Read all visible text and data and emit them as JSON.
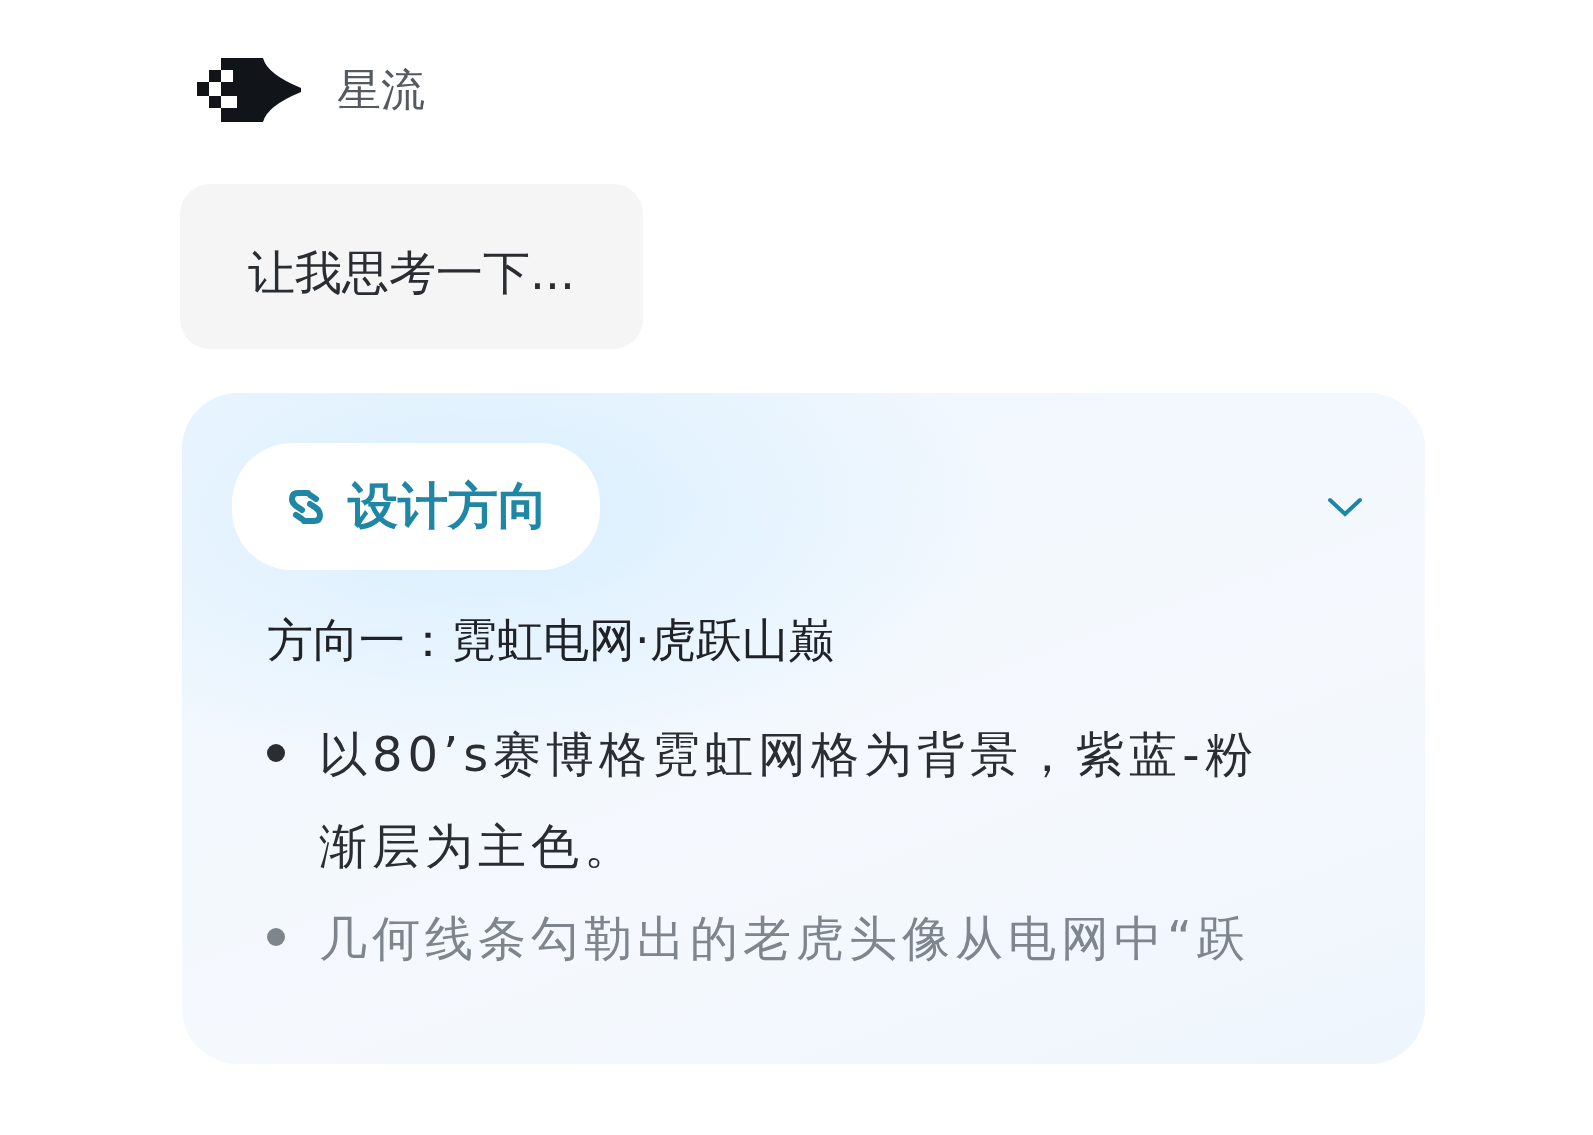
{
  "assistant": {
    "name": "星流"
  },
  "thinking": {
    "text": "让我思考一下..."
  },
  "card": {
    "chip": "设计方向",
    "expanded": true,
    "heading": "方向一：霓虹电网·虎跃山巅",
    "bullets": [
      "以80’s赛博格霓虹网格为背景，紫蓝-粉渐层为主色。",
      "几何线条勾勒出的老虎头像从电网中“跃"
    ]
  }
}
